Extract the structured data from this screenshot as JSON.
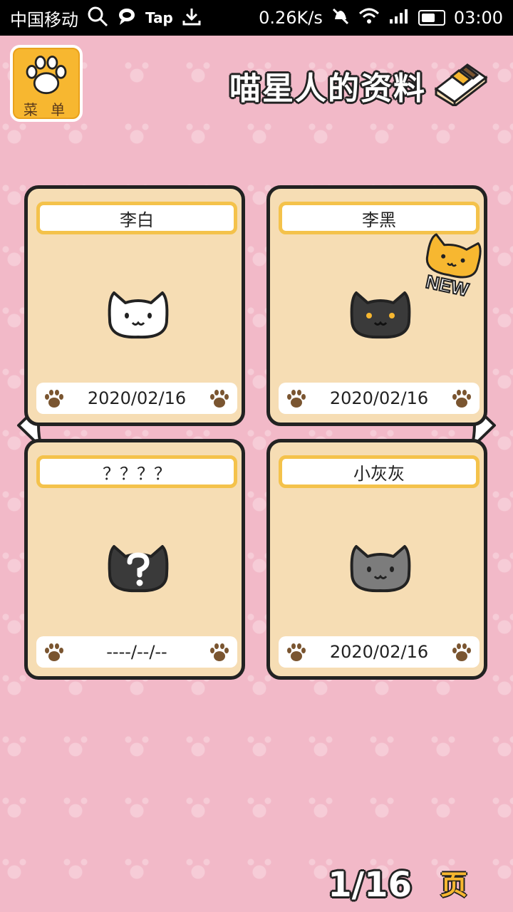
{
  "status_bar": {
    "carrier": "中国移动",
    "app_badge": "Tap",
    "speed": "0.26K/s",
    "time": "03:00"
  },
  "menu": {
    "label": "菜 单"
  },
  "header": {
    "title": "喵星人的资料"
  },
  "cards": [
    {
      "name": "李白",
      "date": "2020/02/16",
      "cat_color": "#ffffff",
      "is_new": false
    },
    {
      "name": "李黑",
      "date": "2020/02/16",
      "cat_color": "#3a3a3a",
      "is_new": true
    },
    {
      "name": "？？？？",
      "date": "----/--/--",
      "cat_color": "#3a3a3a",
      "is_new": false
    },
    {
      "name": "小灰灰",
      "date": "2020/02/16",
      "cat_color": "#7c7c7c",
      "is_new": false
    }
  ],
  "new_badge_text": "NEW",
  "pager": {
    "current": "1/16",
    "unit": "页"
  },
  "colors": {
    "background": "#f2b9c8",
    "card": "#f6ddb4",
    "accent": "#f7b730",
    "paw": "#7a5530"
  }
}
